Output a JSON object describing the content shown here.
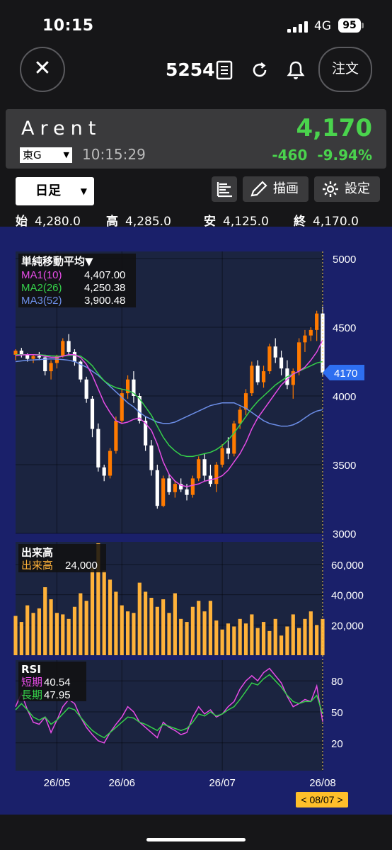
{
  "status_bar": {
    "time": "10:15",
    "network": "4G",
    "battery": "95"
  },
  "top_bar": {
    "code": "5254",
    "order_label": "注文",
    "close_icon": "close-icon",
    "icons": [
      "memo-icon",
      "refresh-icon",
      "bell-icon"
    ]
  },
  "stock": {
    "name": "Arent",
    "price": "4,170",
    "market": "東G",
    "time": "10:15:29",
    "change": "-460",
    "change_pct": "-9.94%"
  },
  "toolbar": {
    "period": "日足",
    "draw_label": "描画",
    "settings_label": "設定"
  },
  "ohlc": {
    "open_label": "始",
    "open": "4,280.0",
    "high_label": "高",
    "high": "4,285.0",
    "low_label": "安",
    "low": "4,125.0",
    "close_label": "終",
    "close": "4,170.0"
  },
  "colors": {
    "up": "#ff7a00",
    "down": "#ffffff",
    "ma1": "#e64ce6",
    "ma2": "#35d04a",
    "ma3": "#6c8ee8",
    "volume": "#ffb23a",
    "rsi_short": "#e64ce6",
    "rsi_long": "#35d04a",
    "accent_green": "#4ad34d",
    "price_tag": "#2e6ff0"
  },
  "chart_data": [
    {
      "type": "candlestick",
      "legend": {
        "title": "単純移動平均▼",
        "items": [
          {
            "label": "MA1(10)",
            "value": "4,407.00"
          },
          {
            "label": "MA2(26)",
            "value": "4,250.38"
          },
          {
            "label": "MA3(52)",
            "value": "3,900.48"
          }
        ]
      },
      "y_ticks": [
        3000,
        3500,
        4000,
        4500,
        5000
      ],
      "y_tick_labels": [
        "3000",
        "3500",
        "4000",
        "4500",
        "5000"
      ],
      "ylim": [
        3000,
        5000
      ],
      "current_price_label": "4170",
      "ohlc": [
        [
          4300,
          4340,
          4260,
          4330
        ],
        [
          4330,
          4350,
          4280,
          4300
        ],
        [
          4300,
          4310,
          4250,
          4270
        ],
        [
          4270,
          4300,
          4240,
          4290
        ],
        [
          4290,
          4320,
          4260,
          4280
        ],
        [
          4280,
          4300,
          4150,
          4180
        ],
        [
          4180,
          4260,
          4120,
          4240
        ],
        [
          4240,
          4300,
          4200,
          4290
        ],
        [
          4290,
          4420,
          4280,
          4400
        ],
        [
          4400,
          4450,
          4300,
          4320
        ],
        [
          4320,
          4340,
          4220,
          4250
        ],
        [
          4250,
          4260,
          4100,
          4120
        ],
        [
          4120,
          4140,
          3950,
          3980
        ],
        [
          3980,
          4000,
          3700,
          3760
        ],
        [
          3760,
          3800,
          3450,
          3480
        ],
        [
          3480,
          3500,
          3380,
          3420
        ],
        [
          3420,
          3620,
          3400,
          3600
        ],
        [
          3600,
          3850,
          3580,
          3820
        ],
        [
          3820,
          4050,
          3800,
          4020
        ],
        [
          4020,
          4150,
          3980,
          4120
        ],
        [
          4120,
          4180,
          3950,
          4000
        ],
        [
          4000,
          4020,
          3800,
          3820
        ],
        [
          3820,
          3850,
          3600,
          3640
        ],
        [
          3640,
          3680,
          3420,
          3460
        ],
        [
          3460,
          3500,
          3180,
          3200
        ],
        [
          3200,
          3420,
          3190,
          3400
        ],
        [
          3400,
          3430,
          3280,
          3300
        ],
        [
          3300,
          3380,
          3260,
          3360
        ],
        [
          3360,
          3400,
          3300,
          3320
        ],
        [
          3320,
          3360,
          3240,
          3280
        ],
        [
          3280,
          3420,
          3260,
          3400
        ],
        [
          3400,
          3560,
          3380,
          3540
        ],
        [
          3540,
          3580,
          3380,
          3420
        ],
        [
          3420,
          3500,
          3340,
          3360
        ],
        [
          3360,
          3520,
          3300,
          3500
        ],
        [
          3500,
          3650,
          3480,
          3620
        ],
        [
          3620,
          3700,
          3540,
          3580
        ],
        [
          3580,
          3820,
          3560,
          3800
        ],
        [
          3800,
          3920,
          3760,
          3900
        ],
        [
          3900,
          4050,
          3860,
          4020
        ],
        [
          4020,
          4250,
          4000,
          4220
        ],
        [
          4220,
          4260,
          4080,
          4100
        ],
        [
          4100,
          4220,
          4060,
          4180
        ],
        [
          4180,
          4380,
          4160,
          4360
        ],
        [
          4360,
          4420,
          4240,
          4280
        ],
        [
          4280,
          4330,
          4150,
          4200
        ],
        [
          4200,
          4260,
          4050,
          4080
        ],
        [
          4080,
          4200,
          3980,
          4180
        ],
        [
          4180,
          4420,
          4150,
          4390
        ],
        [
          4390,
          4480,
          4320,
          4440
        ],
        [
          4440,
          4500,
          4400,
          4480
        ],
        [
          4480,
          4620,
          4400,
          4600
        ],
        [
          4600,
          4650,
          4150,
          4170
        ]
      ],
      "ma1": [
        4295,
        4298,
        4300,
        4300,
        4298,
        4288,
        4282,
        4280,
        4290,
        4300,
        4300,
        4280,
        4230,
        4150,
        4050,
        3950,
        3880,
        3820,
        3800,
        3810,
        3830,
        3840,
        3800,
        3750,
        3650,
        3520,
        3430,
        3380,
        3350,
        3340,
        3350,
        3360,
        3380,
        3390,
        3400,
        3420,
        3460,
        3520,
        3580,
        3660,
        3760,
        3840,
        3900,
        3960,
        4020,
        4080,
        4120,
        4160,
        4180,
        4210,
        4260,
        4320,
        4407
      ],
      "ma2": [
        4300,
        4300,
        4300,
        4300,
        4300,
        4296,
        4292,
        4290,
        4290,
        4295,
        4297,
        4290,
        4260,
        4220,
        4160,
        4110,
        4080,
        4060,
        4050,
        4040,
        4020,
        3980,
        3920,
        3860,
        3780,
        3700,
        3640,
        3600,
        3570,
        3560,
        3560,
        3570,
        3580,
        3590,
        3610,
        3640,
        3680,
        3730,
        3790,
        3850,
        3910,
        3960,
        4000,
        4040,
        4080,
        4110,
        4140,
        4160,
        4180,
        4200,
        4220,
        4240,
        4250.38
      ],
      "ma3": [
        4250,
        4255,
        4260,
        4262,
        4265,
        4268,
        4270,
        4268,
        4265,
        4260,
        4250,
        4230,
        4210,
        4180,
        4150,
        4110,
        4070,
        4030,
        3990,
        3950,
        3920,
        3880,
        3850,
        3830,
        3810,
        3800,
        3800,
        3810,
        3830,
        3850,
        3870,
        3890,
        3910,
        3930,
        3940,
        3950,
        3950,
        3950,
        3930,
        3910,
        3880,
        3850,
        3820,
        3800,
        3790,
        3780,
        3780,
        3790,
        3810,
        3840,
        3870,
        3890,
        3900.48
      ]
    },
    {
      "type": "bar",
      "title": "出来高",
      "legend": {
        "label": "出来高",
        "value": "24,000"
      },
      "y_ticks": [
        20000,
        40000,
        60000
      ],
      "y_tick_labels": [
        "20,000",
        "40,000",
        "60,000"
      ],
      "ylim": [
        0,
        75000
      ],
      "values": [
        26000,
        22000,
        33000,
        28000,
        31000,
        45000,
        37000,
        28000,
        27000,
        24000,
        32000,
        41000,
        36000,
        58000,
        74000,
        56000,
        50000,
        42000,
        33000,
        29000,
        28000,
        48000,
        42000,
        38000,
        32000,
        37000,
        28000,
        41000,
        24000,
        22000,
        32000,
        36000,
        29000,
        36000,
        23000,
        17000,
        21000,
        19000,
        24000,
        21000,
        27000,
        18000,
        22000,
        16000,
        24000,
        13000,
        19000,
        27000,
        18000,
        24000,
        29000,
        20000,
        24000
      ]
    },
    {
      "type": "line",
      "title": "RSI",
      "legend": [
        {
          "label": "短期",
          "value": "40.54"
        },
        {
          "label": "長期",
          "value": "47.95"
        }
      ],
      "y_ticks": [
        20,
        50,
        80
      ],
      "y_tick_labels": [
        "20",
        "50",
        "80"
      ],
      "ylim": [
        0,
        100
      ],
      "x_tick_labels": [
        "26/05",
        "26/06",
        "26/07",
        "26/08"
      ],
      "x_tick_index": [
        7,
        18,
        35,
        52
      ],
      "cursor_label": "< 08/07 >",
      "series": [
        {
          "name": "短期",
          "values": [
            55,
            68,
            52,
            40,
            38,
            45,
            30,
            42,
            55,
            62,
            58,
            45,
            35,
            28,
            22,
            20,
            30,
            38,
            45,
            55,
            50,
            40,
            35,
            30,
            25,
            40,
            35,
            32,
            28,
            30,
            45,
            55,
            48,
            52,
            45,
            48,
            55,
            60,
            72,
            80,
            85,
            80,
            88,
            92,
            85,
            78,
            65,
            55,
            58,
            62,
            60,
            75,
            40.54
          ]
        },
        {
          "name": "長期",
          "values": [
            52,
            58,
            52,
            45,
            42,
            45,
            38,
            42,
            48,
            54,
            52,
            45,
            38,
            32,
            28,
            25,
            30,
            35,
            40,
            45,
            44,
            40,
            38,
            35,
            32,
            38,
            36,
            34,
            32,
            34,
            40,
            48,
            46,
            50,
            46,
            48,
            52,
            55,
            62,
            70,
            78,
            76,
            82,
            86,
            80,
            74,
            66,
            60,
            58,
            60,
            60,
            66,
            47.95
          ]
        }
      ]
    }
  ]
}
